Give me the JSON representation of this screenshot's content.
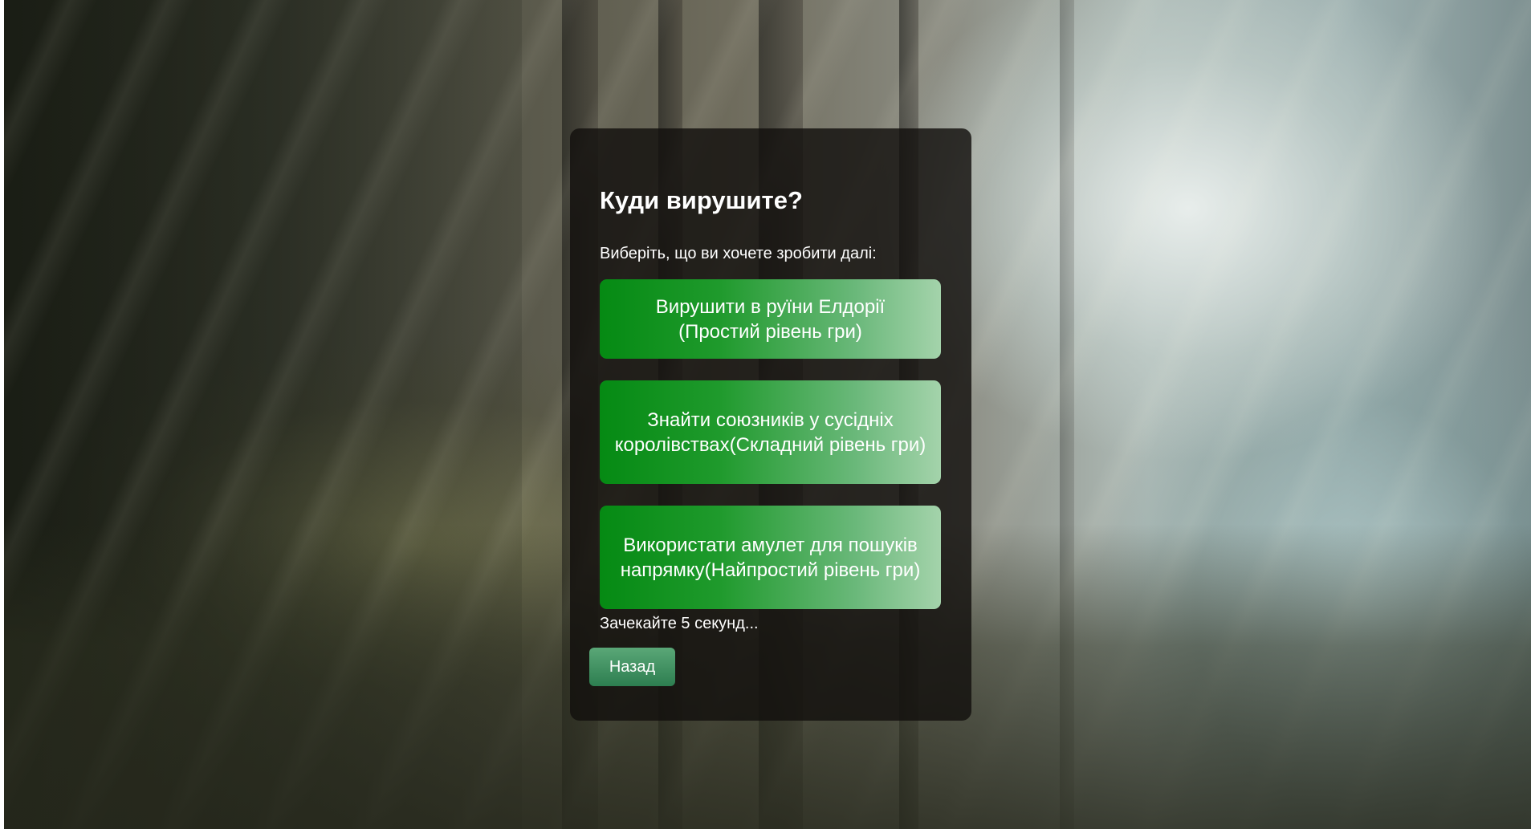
{
  "screen": {
    "background_scene": "misty-forest-with-sun-rays"
  },
  "dialog": {
    "title": "Куди вирушите?",
    "subtitle": "Виберіть, що ви хочете зробити далі:",
    "choices": [
      {
        "label": "Вирушити в руїни Елдорії (Простий рівень гри)"
      },
      {
        "label": "Знайти союзників у сусідніх королівствах(Складний рівень гри)"
      },
      {
        "label": "Використати амулет для пошуків напрямку(Найпростий рівень гри)"
      }
    ],
    "timer_text": "Зачекайте 5 секунд...",
    "back_label": "Назад"
  },
  "colors": {
    "panel_bg": "#12100e",
    "choice_gradient_start": "#058a13",
    "choice_gradient_end": "#a4d3ab",
    "back_button": "#3e8f5f"
  }
}
